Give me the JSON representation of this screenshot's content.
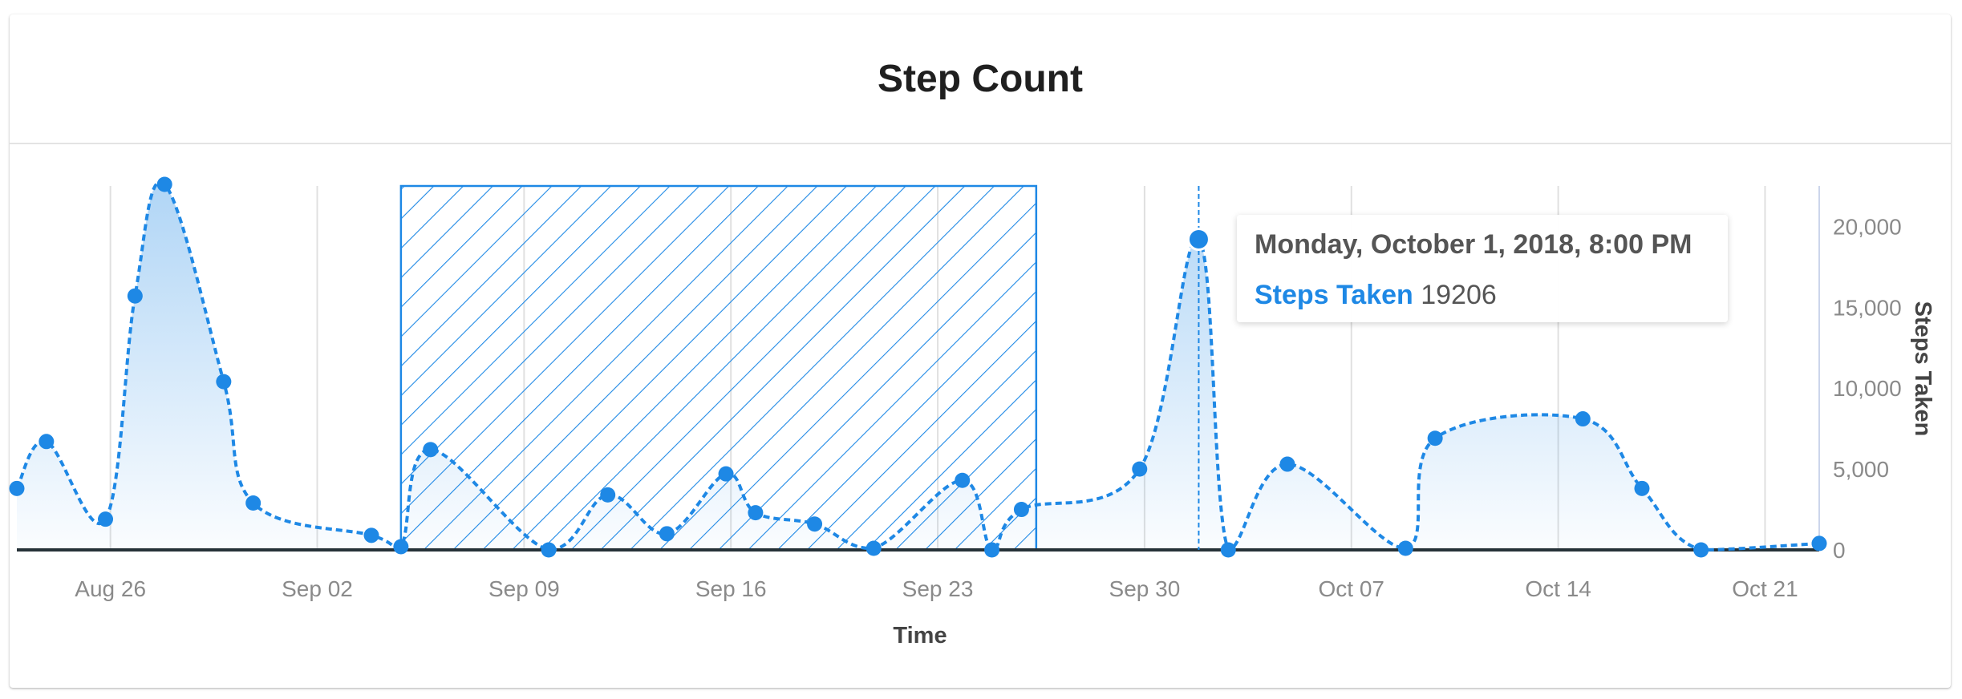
{
  "card": {
    "title": "Step Count"
  },
  "tooltip": {
    "date": "Monday, October 1, 2018, 8:00 PM",
    "series": "Steps Taken",
    "value": "19206"
  },
  "colors": {
    "series": "#1e88e5",
    "axis": "#263238",
    "grid": "#e0e0e0",
    "tick_text": "#8a8a8a"
  },
  "chart_data": {
    "type": "area",
    "title": "Step Count",
    "xlabel": "Time",
    "ylabel": "Steps Taken",
    "ylim": [
      0,
      22500
    ],
    "yticks": [
      0,
      5000,
      10000,
      15000,
      20000
    ],
    "ytick_labels": [
      "0",
      "5,000",
      "10,000",
      "15,000",
      "20,000"
    ],
    "xlim": [
      "2018-08-22T20:00",
      "2018-10-22T20:00"
    ],
    "xticks": [
      "2018-08-26",
      "2018-09-02",
      "2018-09-09",
      "2018-09-16",
      "2018-09-23",
      "2018-09-30",
      "2018-10-07",
      "2018-10-14",
      "2018-10-21"
    ],
    "xtick_labels": [
      "Aug 26",
      "Sep 02",
      "Sep 09",
      "Sep 16",
      "Sep 23",
      "Sep 30",
      "Oct 07",
      "Oct 14",
      "Oct 21"
    ],
    "y_axis_position": "right",
    "grid": "x-only",
    "highlight_band": {
      "start": "2018-09-04T20:00",
      "end": "2018-09-26T08:00",
      "pattern": "diagonal-hatch"
    },
    "hover_point": {
      "x": "2018-10-01T20:00",
      "y": 19206
    },
    "series": [
      {
        "name": "Steps Taken",
        "style": "dashed-line-with-markers-and-gradient-area",
        "points": [
          {
            "x": "2018-08-22T20:00",
            "y": 3800
          },
          {
            "x": "2018-08-23T20:00",
            "y": 6700
          },
          {
            "x": "2018-08-25T20:00",
            "y": 1900
          },
          {
            "x": "2018-08-26T20:00",
            "y": 15700
          },
          {
            "x": "2018-08-27T20:00",
            "y": 22600
          },
          {
            "x": "2018-08-29T20:00",
            "y": 10400
          },
          {
            "x": "2018-08-30T20:00",
            "y": 2900
          },
          {
            "x": "2018-09-03T20:00",
            "y": 900
          },
          {
            "x": "2018-09-04T20:00",
            "y": 200
          },
          {
            "x": "2018-09-05T20:00",
            "y": 6200
          },
          {
            "x": "2018-09-09T20:00",
            "y": 0
          },
          {
            "x": "2018-09-11T20:00",
            "y": 3400
          },
          {
            "x": "2018-09-13T20:00",
            "y": 1000
          },
          {
            "x": "2018-09-15T20:00",
            "y": 4700
          },
          {
            "x": "2018-09-16T20:00",
            "y": 2300
          },
          {
            "x": "2018-09-18T20:00",
            "y": 1600
          },
          {
            "x": "2018-09-20T20:00",
            "y": 100
          },
          {
            "x": "2018-09-23T20:00",
            "y": 4300
          },
          {
            "x": "2018-09-24T20:00",
            "y": 0
          },
          {
            "x": "2018-09-25T20:00",
            "y": 2500
          },
          {
            "x": "2018-09-29T20:00",
            "y": 5000
          },
          {
            "x": "2018-10-01T20:00",
            "y": 19206
          },
          {
            "x": "2018-10-02T20:00",
            "y": 0
          },
          {
            "x": "2018-10-04T20:00",
            "y": 5300
          },
          {
            "x": "2018-10-08T20:00",
            "y": 100
          },
          {
            "x": "2018-10-09T20:00",
            "y": 6900
          },
          {
            "x": "2018-10-14T20:00",
            "y": 8100
          },
          {
            "x": "2018-10-16T20:00",
            "y": 3800
          },
          {
            "x": "2018-10-18T20:00",
            "y": 0
          },
          {
            "x": "2018-10-22T20:00",
            "y": 400
          }
        ]
      }
    ]
  }
}
